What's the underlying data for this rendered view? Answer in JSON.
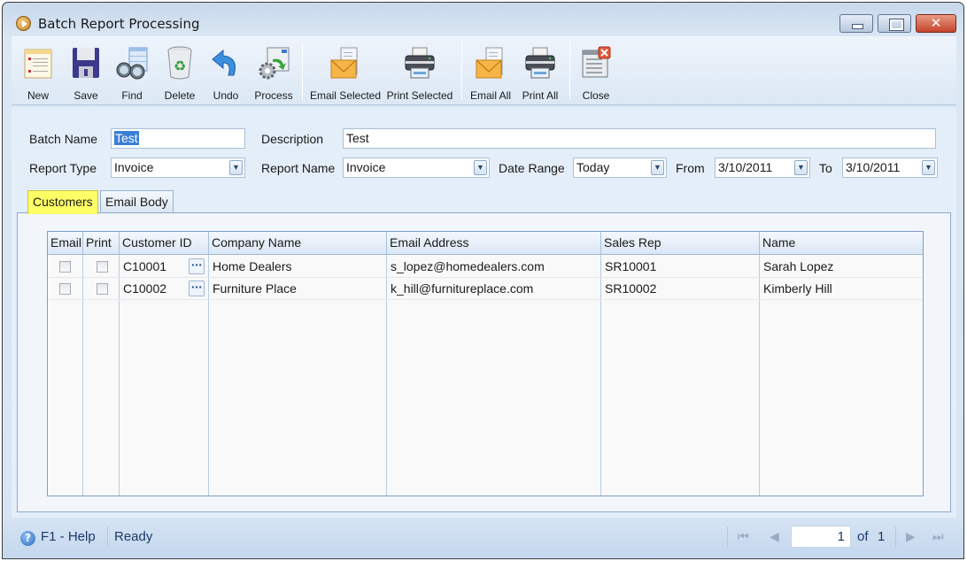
{
  "window": {
    "title": "Batch Report Processing",
    "controls": {
      "minimize": "minimize",
      "maximize": "maximize",
      "close": "✕"
    }
  },
  "toolbar": {
    "buttons": [
      {
        "id": "new",
        "label": "New",
        "icon": "new-document-icon"
      },
      {
        "id": "save",
        "label": "Save",
        "icon": "floppy-disk-icon"
      },
      {
        "id": "find",
        "label": "Find",
        "icon": "binoculars-icon"
      },
      {
        "id": "delete",
        "label": "Delete",
        "icon": "recycle-bin-icon"
      },
      {
        "id": "undo",
        "label": "Undo",
        "icon": "undo-arrow-icon"
      },
      {
        "id": "process",
        "label": "Process",
        "icon": "process-gear-icon"
      },
      {
        "id": "email-selected",
        "label": "Email Selected",
        "icon": "envelope-icon"
      },
      {
        "id": "print-selected",
        "label": "Print Selected",
        "icon": "printer-icon"
      },
      {
        "id": "email-all",
        "label": "Email All",
        "icon": "envelope-icon"
      },
      {
        "id": "print-all",
        "label": "Print All",
        "icon": "printer-icon"
      },
      {
        "id": "close",
        "label": "Close",
        "icon": "close-window-icon"
      }
    ]
  },
  "form": {
    "batch_name": {
      "label": "Batch Name",
      "value": "Test"
    },
    "description": {
      "label": "Description",
      "value": "Test"
    },
    "report_type": {
      "label": "Report Type",
      "value": "Invoice"
    },
    "report_name": {
      "label": "Report Name",
      "value": "Invoice"
    },
    "date_range": {
      "label": "Date Range",
      "value": "Today"
    },
    "from": {
      "label": "From",
      "value": "3/10/2011"
    },
    "to": {
      "label": "To",
      "value": "3/10/2011"
    }
  },
  "tabs": [
    {
      "label": "Customers",
      "active": true
    },
    {
      "label": "Email Body",
      "active": false
    }
  ],
  "grid": {
    "columns": [
      "Email",
      "Print",
      "Customer ID",
      "Company Name",
      "Email Address",
      "Sales Rep",
      "Name"
    ],
    "rows": [
      {
        "email": false,
        "print": false,
        "customer_id": "C10001",
        "company": "Home Dealers",
        "email_address": "s_lopez@homedealers.com",
        "sales_rep": "SR10001",
        "name": "Sarah Lopez"
      },
      {
        "email": false,
        "print": false,
        "customer_id": "C10002",
        "company": "Furniture Place",
        "email_address": "k_hill@furnitureplace.com",
        "sales_rep": "SR10002",
        "name": "Kimberly  Hill"
      }
    ],
    "lookup_glyph": "···"
  },
  "statusbar": {
    "help": "F1 - Help",
    "status": "Ready",
    "page_current": "1",
    "page_of_label": "of",
    "page_total": "1",
    "nav": {
      "first": "⏮",
      "prev": "◀",
      "next": "▶",
      "last": "⏭"
    }
  },
  "colors": {
    "active_tab_highlight": "#ffff66",
    "selection": "#3b7fd4"
  }
}
